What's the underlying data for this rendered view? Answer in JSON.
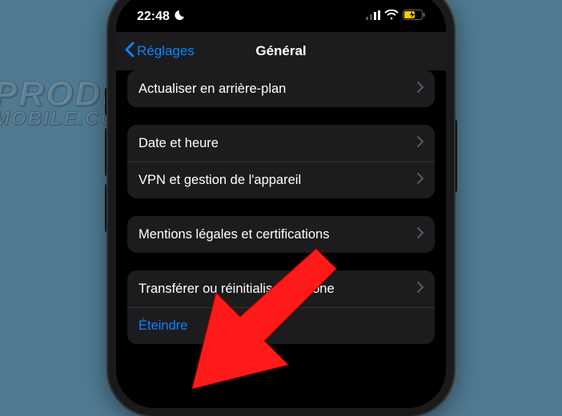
{
  "watermark": {
    "line1": "PRODIGE",
    "line2": "MOBILE.COM"
  },
  "status_bar": {
    "time": "22:48"
  },
  "nav": {
    "back_label": "Réglages",
    "title": "Général"
  },
  "rows": {
    "refresh": "Actualiser en arrière-plan",
    "datetime": "Date et heure",
    "vpn": "VPN et gestion de l'appareil",
    "legal": "Mentions légales et certifications",
    "transfer": "Transférer ou réinitialiser l'iPhone",
    "shutdown": "Éteindre"
  }
}
